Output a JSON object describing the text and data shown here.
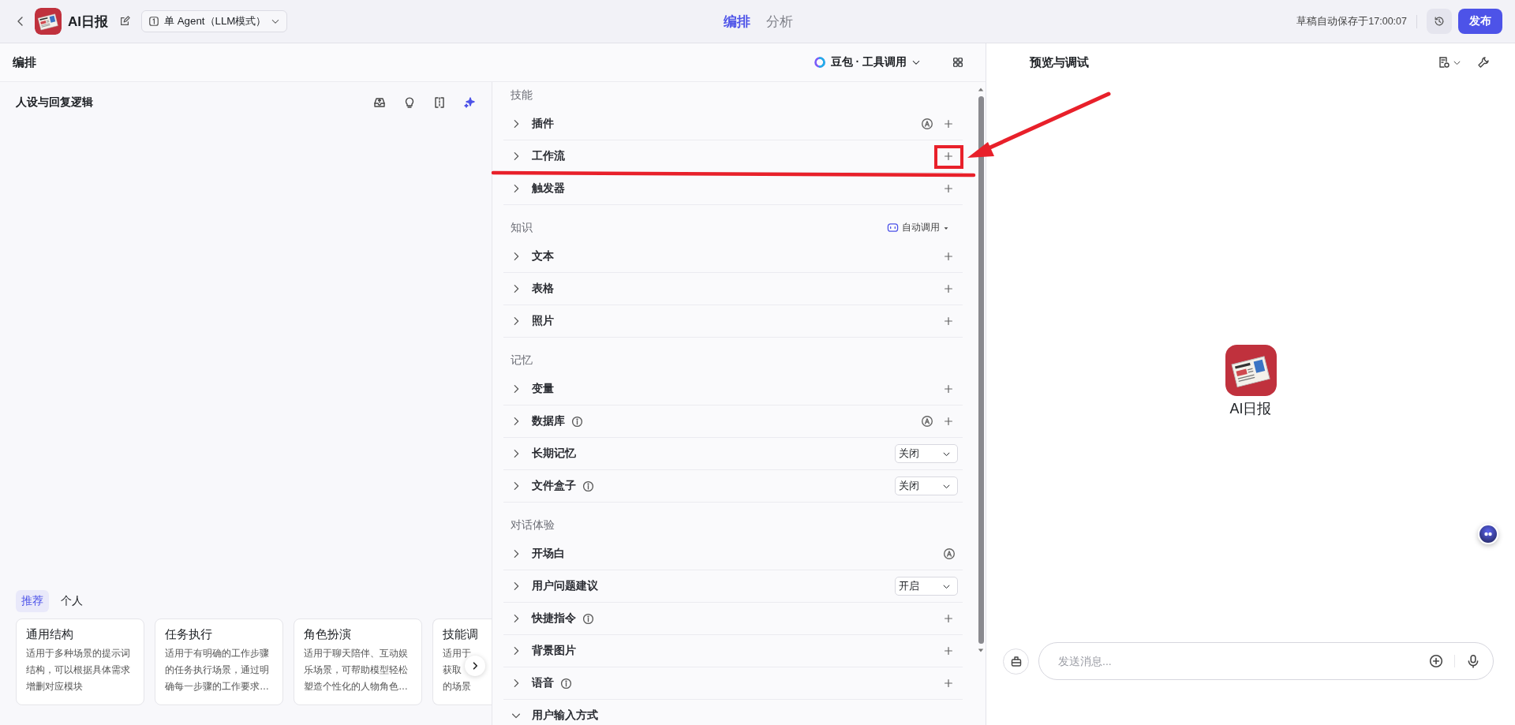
{
  "app": {
    "title": "AI日报",
    "mode": "单 Agent（LLM模式）"
  },
  "nav_tabs": [
    {
      "label": "编排",
      "selected": true
    },
    {
      "label": "分析",
      "selected": false
    }
  ],
  "save_status": "草稿自动保存于17:00:07",
  "publish_button": "发布",
  "editor": {
    "title": "编排",
    "model": "豆包 · 工具调用"
  },
  "persona": {
    "title": "人设与回复逻辑",
    "template_tabs": [
      {
        "label": "推荐",
        "selected": true
      },
      {
        "label": "个人",
        "selected": false
      }
    ],
    "templates": [
      {
        "title": "通用结构",
        "description": "适用于多种场景的提示词结构，可以根据具体需求增删对应模块"
      },
      {
        "title": "任务执行",
        "description": "适用于有明确的工作步骤的任务执行场景，通过明确每一步骤的工作要求…"
      },
      {
        "title": "角色扮演",
        "description": "适用于聊天陪伴、互动娱乐场景，可帮助模型轻松塑造个性化的人物角色…"
      },
      {
        "title": "技能调",
        "lines": [
          "适用于",
          "获取",
          "的场景"
        ]
      }
    ]
  },
  "sections": [
    {
      "title": "技能",
      "items": [
        {
          "label": "插件",
          "kind": "auto_add",
          "info": false,
          "expanded": false
        },
        {
          "label": "工作流",
          "kind": "add",
          "info": false,
          "expanded": false
        },
        {
          "label": "触发器",
          "kind": "add",
          "info": false,
          "expanded": false
        }
      ]
    },
    {
      "title": "知识",
      "action": "自动调用",
      "items": [
        {
          "label": "文本",
          "kind": "add",
          "info": false,
          "expanded": false
        },
        {
          "label": "表格",
          "kind": "add",
          "info": false,
          "expanded": false
        },
        {
          "label": "照片",
          "kind": "add",
          "info": false,
          "expanded": false
        }
      ]
    },
    {
      "title": "记忆",
      "items": [
        {
          "label": "变量",
          "kind": "add",
          "info": false,
          "expanded": false
        },
        {
          "label": "数据库",
          "kind": "auto_add",
          "info": true,
          "expanded": false
        },
        {
          "label": "长期记忆",
          "kind": "select",
          "value": "关闭",
          "info": false,
          "expanded": false
        },
        {
          "label": "文件盒子",
          "kind": "select",
          "value": "关闭",
          "info": true,
          "expanded": false
        }
      ]
    },
    {
      "title": "对话体验",
      "items": [
        {
          "label": "开场白",
          "kind": "auto",
          "info": false,
          "expanded": false
        },
        {
          "label": "用户问题建议",
          "kind": "select",
          "value": "开启",
          "info": false,
          "expanded": false
        },
        {
          "label": "快捷指令",
          "kind": "add",
          "info": true,
          "expanded": false
        },
        {
          "label": "背景图片",
          "kind": "add",
          "info": false,
          "expanded": false
        },
        {
          "label": "语音",
          "kind": "add",
          "info": true,
          "expanded": false
        },
        {
          "label": "用户输入方式",
          "kind": "plain",
          "info": false,
          "expanded": true
        }
      ]
    }
  ],
  "preview": {
    "title": "预览与调试",
    "bot_name": "AI日报",
    "input_placeholder": "发送消息..."
  },
  "annotations": [
    {
      "kind": "arrow"
    },
    {
      "kind": "box"
    },
    {
      "kind": "line"
    }
  ]
}
